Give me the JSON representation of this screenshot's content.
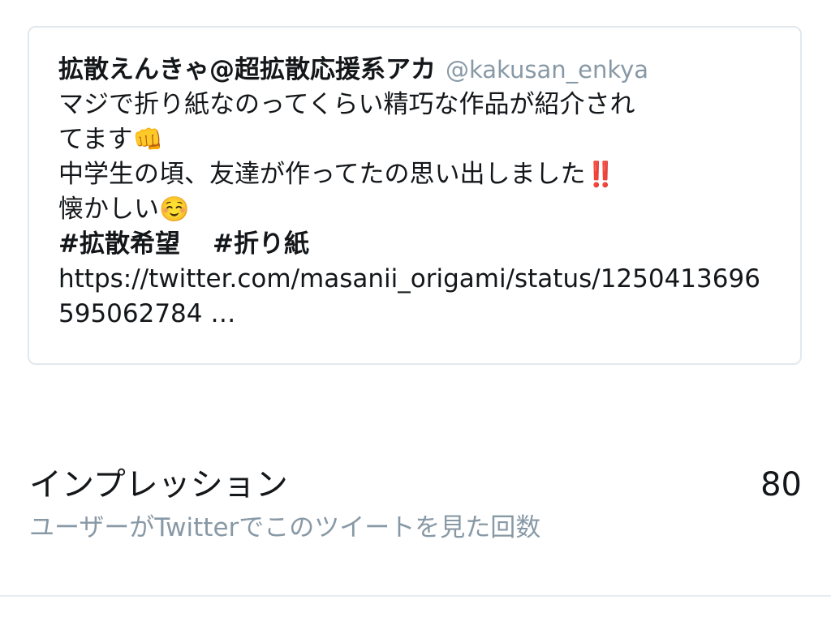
{
  "tweet": {
    "display_name": "拡散えんきゃ@超拡散応援系アカ",
    "handle": "@kakusan_enkya",
    "lines": [
      "マジで折り紙なのってくらい精巧な作品が紹介され",
      "てます",
      "中学生の頃、友達が作ってたの思い出しました",
      "懐かしい"
    ],
    "emojis": {
      "fist": "👊",
      "double_exclamation": "‼️",
      "smile": "☺️"
    },
    "hashtags": [
      "#拡散希望",
      "#折り紙"
    ],
    "link": "https://twitter.com/masanii_origami/status/1250413696595062784 …"
  },
  "impressions": {
    "title": "インプレッション",
    "value": "80",
    "description": "ユーザーがTwitterでこのツイートを見た回数"
  }
}
